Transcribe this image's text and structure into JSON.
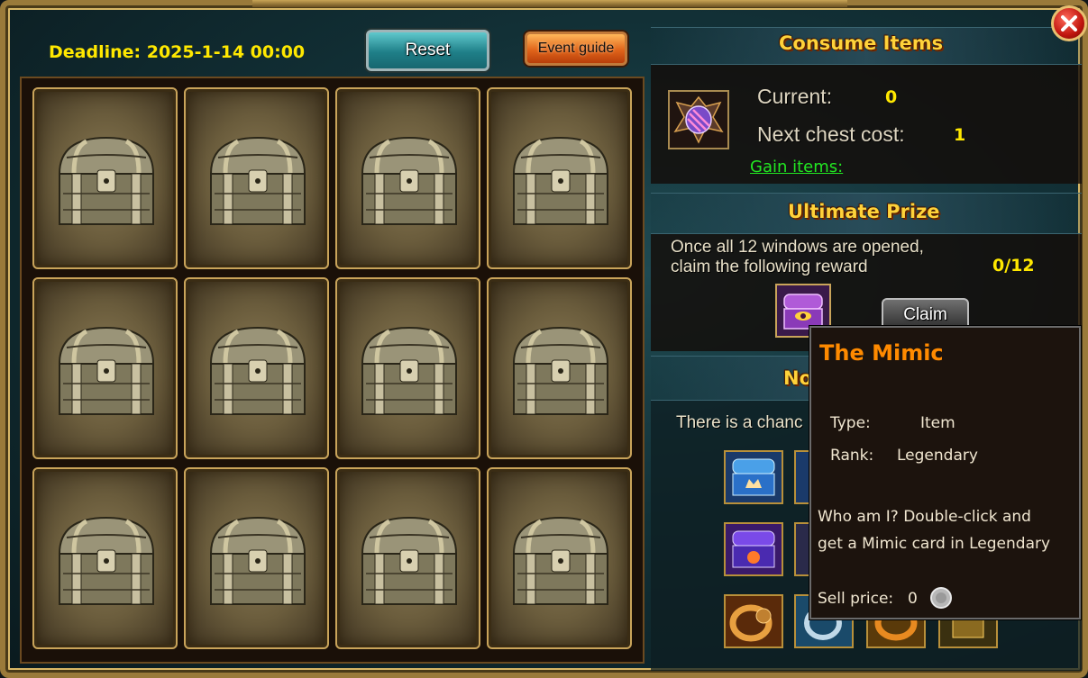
{
  "header": {
    "deadline": "Deadline: 2025-1-14 00:00",
    "reset_label": "Reset",
    "guide_label": "Event guide"
  },
  "chests": [
    {
      "id": 1
    },
    {
      "id": 2
    },
    {
      "id": 3
    },
    {
      "id": 4
    },
    {
      "id": 5
    },
    {
      "id": 6
    },
    {
      "id": 7
    },
    {
      "id": 8
    },
    {
      "id": 9
    },
    {
      "id": 10
    },
    {
      "id": 11
    },
    {
      "id": 12
    }
  ],
  "consume": {
    "title": "Consume Items",
    "current_label": "Current:",
    "current_value": "0",
    "next_label": "Next chest cost:",
    "next_value": "1",
    "gain_link": "Gain items:"
  },
  "ultimate": {
    "title": "Ultimate Prize",
    "desc_line1": "Once all 12 windows are opened,",
    "desc_line2": "claim the following reward",
    "progress": "0/12",
    "claim_label": "Claim"
  },
  "normal": {
    "title_partial": "No",
    "chance_partial": "There is a chanc"
  },
  "tooltip": {
    "title": "The Mimic",
    "type_label": "Type:",
    "type_value": "Item",
    "rank_label": "Rank:",
    "rank_value": "Legendary",
    "desc_line1": "Who am I? Double-click and",
    "desc_line2": "get a Mimic card in Legendary",
    "sell_label": "Sell price:",
    "sell_value": "0"
  },
  "colors": {
    "deadline": "#ffe800",
    "section_title": "#ffd23a",
    "gain_link": "#22e622",
    "tooltip_title": "#ff8a00"
  }
}
